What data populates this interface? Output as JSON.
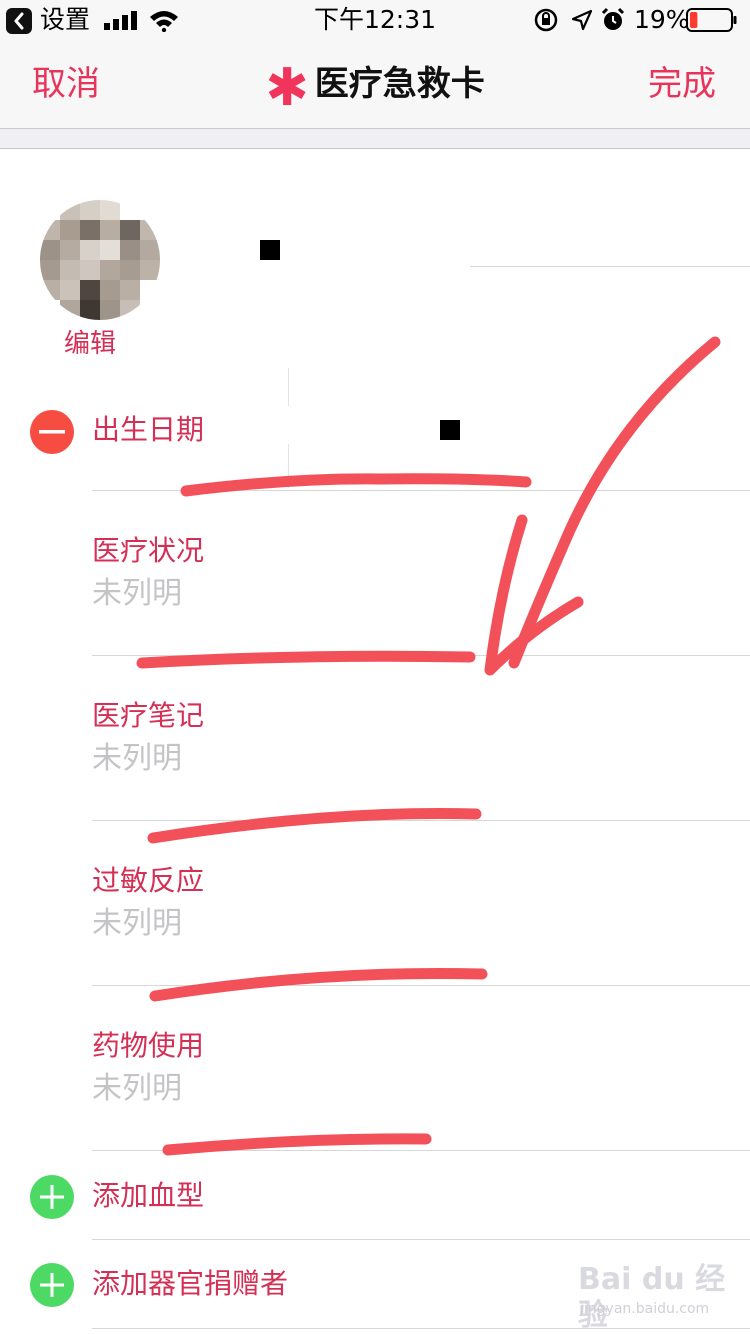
{
  "status_bar": {
    "back_app": "设置",
    "time": "下午12:31",
    "battery_percent": "19%",
    "battery_level": 0.19,
    "icons": [
      "back-chevron-icon",
      "signal-bars-icon",
      "wifi-icon",
      "rotation-lock-icon",
      "location-arrow-icon",
      "alarm-clock-icon",
      "battery-icon"
    ]
  },
  "nav": {
    "cancel_label": "取消",
    "title": "医疗急救卡",
    "title_icon": "asterisk-icon",
    "done_label": "完成"
  },
  "profile": {
    "edit_label": "编辑"
  },
  "rows": [
    {
      "label": "出生日期",
      "value": "",
      "control": "remove-circle-icon"
    },
    {
      "label": "医疗状况",
      "value": "未列明"
    },
    {
      "label": "医疗笔记",
      "value": "未列明"
    },
    {
      "label": "过敏反应",
      "value": "未列明"
    },
    {
      "label": "药物使用",
      "value": "未列明"
    }
  ],
  "add_rows": [
    {
      "label": "添加血型",
      "control": "add-circle-icon"
    },
    {
      "label": "添加器官捐赠者",
      "control": "add-circle-icon"
    }
  ],
  "colors": {
    "accent": "#e8345a",
    "label_pink": "#d42f55",
    "placeholder_gray": "#c4c4c7",
    "remove_red": "#f64c42",
    "add_green": "#4cd964",
    "annotation_red": "#f2515a"
  },
  "watermark": {
    "brand": "Bai du 经验",
    "url": "jingyan.baidu.com"
  }
}
